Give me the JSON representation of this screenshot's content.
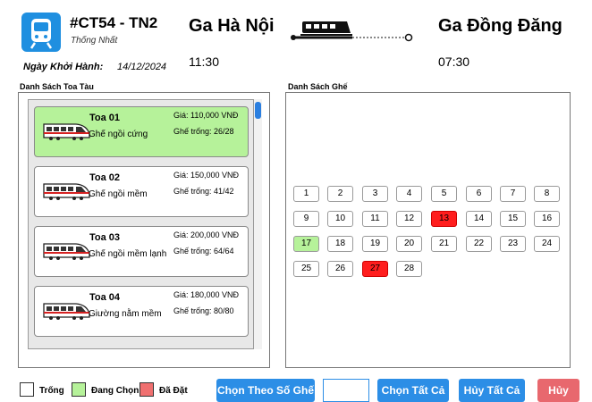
{
  "train": {
    "code": "#CT54 - TN2",
    "subtitle": "Thống Nhất",
    "departure_label": "Ngày Khởi Hành:",
    "departure_date": "14/12/2024"
  },
  "route": {
    "from_station": "Ga Hà Nội",
    "from_time": "11:30",
    "to_station": "Ga Đồng Đăng",
    "to_time": "07:30"
  },
  "carriage_list": {
    "title": "Danh Sách Toa Tàu",
    "items": [
      {
        "name": "Toa 01",
        "type": "Ghế ngồi cứng",
        "price": "Giá: 110,000 VNĐ",
        "free": "Ghế trống: 26/28",
        "selected": true
      },
      {
        "name": "Toa 02",
        "type": "Ghế ngồi mềm",
        "price": "Giá: 150,000 VNĐ",
        "free": "Ghế trống: 41/42",
        "selected": false
      },
      {
        "name": "Toa 03",
        "type": "Ghế ngồi mềm lạnh",
        "price": "Giá: 200,000 VNĐ",
        "free": "Ghế trống: 64/64",
        "selected": false
      },
      {
        "name": "Toa 04",
        "type": "Giường nằm mềm",
        "price": "Giá: 180,000 VNĐ",
        "free": "Ghế trống: 80/80",
        "selected": false
      }
    ]
  },
  "seat_list": {
    "title": "Danh Sách Ghế",
    "seats": [
      {
        "n": "1",
        "state": "empty"
      },
      {
        "n": "2",
        "state": "empty"
      },
      {
        "n": "3",
        "state": "empty"
      },
      {
        "n": "4",
        "state": "empty"
      },
      {
        "n": "5",
        "state": "empty"
      },
      {
        "n": "6",
        "state": "empty"
      },
      {
        "n": "7",
        "state": "empty"
      },
      {
        "n": "8",
        "state": "empty"
      },
      {
        "n": "9",
        "state": "empty"
      },
      {
        "n": "10",
        "state": "empty"
      },
      {
        "n": "11",
        "state": "empty"
      },
      {
        "n": "12",
        "state": "empty"
      },
      {
        "n": "13",
        "state": "taken"
      },
      {
        "n": "14",
        "state": "empty"
      },
      {
        "n": "15",
        "state": "empty"
      },
      {
        "n": "16",
        "state": "empty"
      },
      {
        "n": "17",
        "state": "choosing"
      },
      {
        "n": "18",
        "state": "empty"
      },
      {
        "n": "19",
        "state": "empty"
      },
      {
        "n": "20",
        "state": "empty"
      },
      {
        "n": "21",
        "state": "empty"
      },
      {
        "n": "22",
        "state": "empty"
      },
      {
        "n": "23",
        "state": "empty"
      },
      {
        "n": "24",
        "state": "empty"
      },
      {
        "n": "25",
        "state": "empty"
      },
      {
        "n": "26",
        "state": "empty"
      },
      {
        "n": "27",
        "state": "taken"
      },
      {
        "n": "28",
        "state": "empty"
      }
    ]
  },
  "legend": {
    "empty": "Trống",
    "choosing": "Đang Chọn",
    "taken": "Đã Đặt"
  },
  "actions": {
    "select_by_number": "Chọn Theo Số Ghế",
    "seat_input_value": "",
    "select_all": "Chọn Tất Cả",
    "cancel_all": "Hủy Tất Cả",
    "cancel": "Hủy"
  },
  "colors": {
    "accent": "#2c8ee6",
    "selected": "#b6f29a",
    "taken": "#ff1e1e",
    "cancel": "#e8686e"
  },
  "icons": {
    "logo": "train-front-icon",
    "route": "train-icon",
    "carriage": "train-car-icon"
  }
}
